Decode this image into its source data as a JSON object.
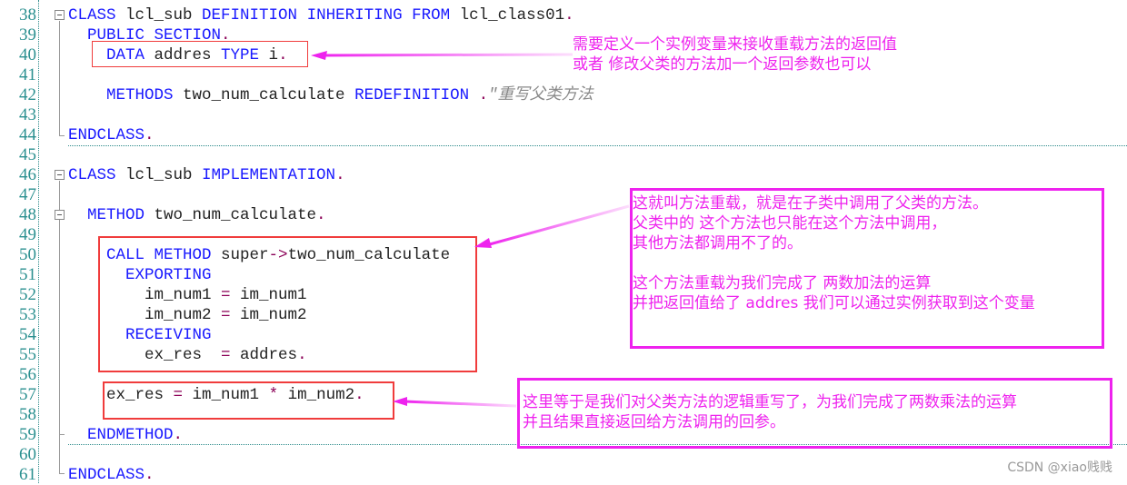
{
  "editor": {
    "lines": [
      {
        "num": "38",
        "tokens": [
          {
            "t": "CLASS",
            "c": "kw"
          },
          {
            "t": " lcl_sub ",
            "c": "id"
          },
          {
            "t": "DEFINITION",
            "c": "kw"
          },
          {
            "t": " ",
            "c": "id"
          },
          {
            "t": "INHERITING FROM",
            "c": "kw"
          },
          {
            "t": " lcl_class01",
            "c": "id"
          },
          {
            "t": ".",
            "c": "op"
          }
        ]
      },
      {
        "num": "39",
        "tokens": [
          {
            "t": "  PUBLIC SECTION",
            "c": "kw"
          },
          {
            "t": ".",
            "c": "op"
          }
        ]
      },
      {
        "num": "40",
        "tokens": [
          {
            "t": "    DATA",
            "c": "kw"
          },
          {
            "t": " addres ",
            "c": "id"
          },
          {
            "t": "TYPE",
            "c": "kw"
          },
          {
            "t": " i",
            "c": "id"
          },
          {
            "t": ".",
            "c": "op"
          }
        ]
      },
      {
        "num": "41",
        "tokens": []
      },
      {
        "num": "42",
        "tokens": [
          {
            "t": "    METHODS",
            "c": "kw"
          },
          {
            "t": " two_num_calculate ",
            "c": "id"
          },
          {
            "t": "REDEFINITION",
            "c": "kw"
          },
          {
            "t": " .",
            "c": "op"
          },
          {
            "t": "\"重写父类方法",
            "c": "cm"
          }
        ]
      },
      {
        "num": "43",
        "tokens": []
      },
      {
        "num": "44",
        "tokens": [
          {
            "t": "ENDCLASS",
            "c": "kw"
          },
          {
            "t": ".",
            "c": "op"
          }
        ]
      },
      {
        "num": "45",
        "tokens": []
      },
      {
        "num": "46",
        "tokens": [
          {
            "t": "CLASS",
            "c": "kw"
          },
          {
            "t": " lcl_sub ",
            "c": "id"
          },
          {
            "t": "IMPLEMENTATION",
            "c": "kw"
          },
          {
            "t": ".",
            "c": "op"
          }
        ]
      },
      {
        "num": "47",
        "tokens": []
      },
      {
        "num": "48",
        "tokens": [
          {
            "t": "  METHOD",
            "c": "kw"
          },
          {
            "t": " two_num_calculate",
            "c": "id"
          },
          {
            "t": ".",
            "c": "op"
          }
        ]
      },
      {
        "num": "49",
        "tokens": []
      },
      {
        "num": "50",
        "tokens": [
          {
            "t": "    CALL METHOD",
            "c": "kw"
          },
          {
            "t": " super",
            "c": "id"
          },
          {
            "t": "->",
            "c": "op"
          },
          {
            "t": "two_num_calculate",
            "c": "id"
          }
        ]
      },
      {
        "num": "51",
        "tokens": [
          {
            "t": "      EXPORTING",
            "c": "kw"
          }
        ]
      },
      {
        "num": "52",
        "tokens": [
          {
            "t": "        im_num1 ",
            "c": "id"
          },
          {
            "t": "=",
            "c": "op"
          },
          {
            "t": " im_num1",
            "c": "id"
          }
        ]
      },
      {
        "num": "53",
        "tokens": [
          {
            "t": "        im_num2 ",
            "c": "id"
          },
          {
            "t": "=",
            "c": "op"
          },
          {
            "t": " im_num2",
            "c": "id"
          }
        ]
      },
      {
        "num": "54",
        "tokens": [
          {
            "t": "      RECEIVING",
            "c": "kw"
          }
        ]
      },
      {
        "num": "55",
        "tokens": [
          {
            "t": "        ex_res  ",
            "c": "id"
          },
          {
            "t": "=",
            "c": "op"
          },
          {
            "t": " addres",
            "c": "id"
          },
          {
            "t": ".",
            "c": "op"
          }
        ]
      },
      {
        "num": "56",
        "tokens": []
      },
      {
        "num": "57",
        "tokens": [
          {
            "t": "    ex_res ",
            "c": "id"
          },
          {
            "t": "=",
            "c": "op"
          },
          {
            "t": " im_num1 ",
            "c": "id"
          },
          {
            "t": "*",
            "c": "op"
          },
          {
            "t": " im_num2",
            "c": "id"
          },
          {
            "t": ".",
            "c": "op"
          }
        ]
      },
      {
        "num": "58",
        "tokens": []
      },
      {
        "num": "59",
        "tokens": [
          {
            "t": "  ENDMETHOD",
            "c": "kw"
          },
          {
            "t": ".",
            "c": "op"
          }
        ]
      },
      {
        "num": "60",
        "tokens": []
      },
      {
        "num": "61",
        "tokens": [
          {
            "t": "ENDCLASS",
            "c": "kw"
          },
          {
            "t": ".",
            "c": "op"
          }
        ]
      }
    ]
  },
  "annotations": {
    "note1": [
      "需要定义一个实例变量来接收重载方法的返回值",
      "或者 修改父类的方法加一个返回参数也可以"
    ],
    "note2": [
      "这就叫方法重载，就是在子类中调用了父类的方法。",
      "父类中的 这个方法也只能在这个方法中调用，",
      "其他方法都调用不了的。",
      "",
      "这个方法重载为我们完成了 两数加法的运算",
      "并把返回值给了 addres 我们可以通过实例获取到这个变量"
    ],
    "note3": [
      "这里等于是我们对父类方法的逻辑重写了，为我们完成了两数乘法的运算",
      "并且结果直接返回给方法调用的回参。"
    ]
  },
  "colors": {
    "annotation": "#ee22ee",
    "highlight_box": "#f03c3c",
    "keyword": "#1a1aff",
    "line_number": "#2b9090"
  },
  "watermark": "CSDN @xiao贱贱"
}
